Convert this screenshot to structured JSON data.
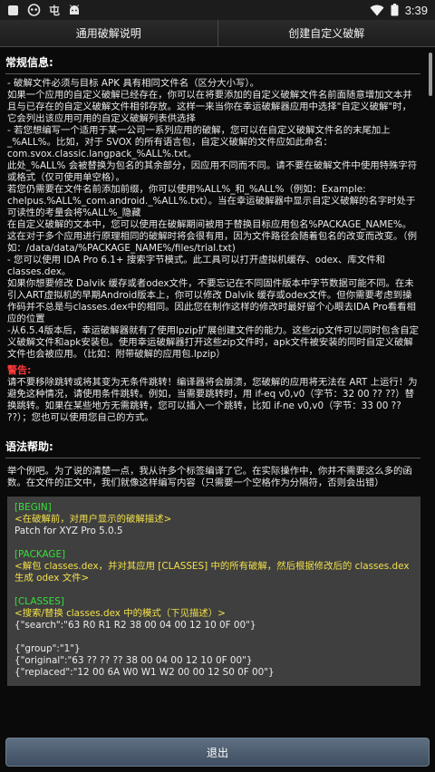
{
  "status_bar": {
    "time": "3:39",
    "app_label": "屯",
    "icons": [
      "notification-square-icon",
      "robot-icon",
      "app-glyph",
      "android-icon",
      "wifi-icon",
      "battery-icon"
    ]
  },
  "tabs": [
    {
      "label": "通用破解说明"
    },
    {
      "label": "创建自定义破解"
    }
  ],
  "general": {
    "title": "常规信息:",
    "p1": "- 破解文件必须与目标 APK 具有相同文件名（区分大小写）。\n如果一个应用的自定义破解已经存在，你可以在将要添加的自定义破解文件名前面随意增加文本并且与已存在的自定义破解文件相邻存放。这样一来当你在幸运破解器应用中选择\"自定义破解\"时，它会列出该应用可用的自定义破解列表供选择\n- 若您想编写一个适用于某一公司一系列应用的破解，您可以在自定义破解文件名的末尾加上 _%ALL%。比如，对于 SVOX 的所有语言包，自定义破解的文件应如此命名：com.svox.classic.langpack_%ALL%.txt。\n此处_%ALL% 会被替换为包名的其余部分，因应用不同而不同。请不要在破解文件中使用特殊字符或格式（仅可使用单空格）。\n若您仍需要在文件名前添加前缀，你可以使用%ALL%_和_%ALL%（例如：Example: chelpus.%ALL%_com.android._%ALL%.txt）。当在幸运破解器中显示自定义破解的名字时处于可读性的考量会将%ALL%_隐藏\n在自定义破解的文本中，您可以使用在破解期间被用于替换目标应用包名%PACKAGE_NAME%。这在对于多个应用进行原理相同的破解时将会很有用，因为文件路径会随着包名的改变而改变。（例如：/data/data/%PACKAGE_NAME%/files/trial.txt)\n- 您可以使用 IDA Pro 6.1+ 搜索字节模式。此工具可以打开虚拟机缓存、odex、库文件和classes.dex。\n如果你想要修改 Dalvik 缓存或者odex文件，不要忘记在不同固件版本中字节数据可能不同。在未引入ART虚拟机的早期Android版本上，你可以修改 Dalvik 缓存或odex文件。但你需要考虑到操作码并不总是与classes.dex中的相同。因此您在制作这样的修改时最好留个心眼去IDA Pro看看相应的位置\n-从6.5.4版本后，幸运破解器就有了使用lpzip扩展创建文件的能力。这些zip文件可以同时包含自定义破解文件和apk安装包。使用幸运破解器打开这些zip文件时，apk文件被安装的同时自定义破解文件也会被应用。（比如：附带破解的应用包.lpzip）",
    "warning_title": "警告:",
    "warning_text": "请不要移除跳转或将其变为无条件跳转！编译器将会崩溃，您破解的应用将无法在 ART 上运行！为避免这种情况，请使用条件跳转。例如，当需要跳转时，用 if-eq v0,v0（字节：32 00 ?? ??）替换跳转。如果在某些地方无需跳转，您可以插入一个跳转，比如 if-ne v0,v0（字节：33 00 ?? ??）；您也可以使用您自己的方式。"
  },
  "syntax": {
    "title": "语法帮助:",
    "intro": "举个例吧。为了说的清楚一点，我从许多个标签编译了它。在实际操作中，你并不需要这么多的函数。在文件的正文中，我们就像这样编写内容（只需要一个空格作为分隔符，否则会出错）",
    "example": [
      {
        "kind": "tag",
        "text": "[BEGIN]"
      },
      {
        "kind": "note",
        "text": "<在破解前，对用户显示的破解描述>"
      },
      {
        "kind": "plain",
        "text": "Patch for XYZ Pro 5.0.5"
      },
      {
        "kind": "space",
        "text": ""
      },
      {
        "kind": "tag",
        "text": "[PACKAGE]"
      },
      {
        "kind": "note",
        "text": "<解包 classes.dex，并对其应用 [CLASSES] 中的所有破解，然后根据修改后的 classes.dex 生成 odex 文件>"
      },
      {
        "kind": "space",
        "text": ""
      },
      {
        "kind": "tag",
        "text": "[CLASSES]"
      },
      {
        "kind": "note",
        "text": "<搜索/替换 classes.dex 中的模式（下见描述）>"
      },
      {
        "kind": "plain",
        "text": "{\"search\":\"63 R0 R1 R2 38 00 04 00 12 10 0F 00\"}"
      },
      {
        "kind": "space",
        "text": ""
      },
      {
        "kind": "plain",
        "text": "{\"group\":\"1\"}"
      },
      {
        "kind": "plain",
        "text": "{\"original\":\"63 ?? ?? ?? 38 00 04 00 12 10 0F 00\"}"
      },
      {
        "kind": "plain",
        "text": "{\"replaced\":\"12 00 6A W0 W1 W2 00 00 12 S0 0F 00\"}"
      }
    ]
  },
  "exit_button": {
    "label": "退出"
  }
}
